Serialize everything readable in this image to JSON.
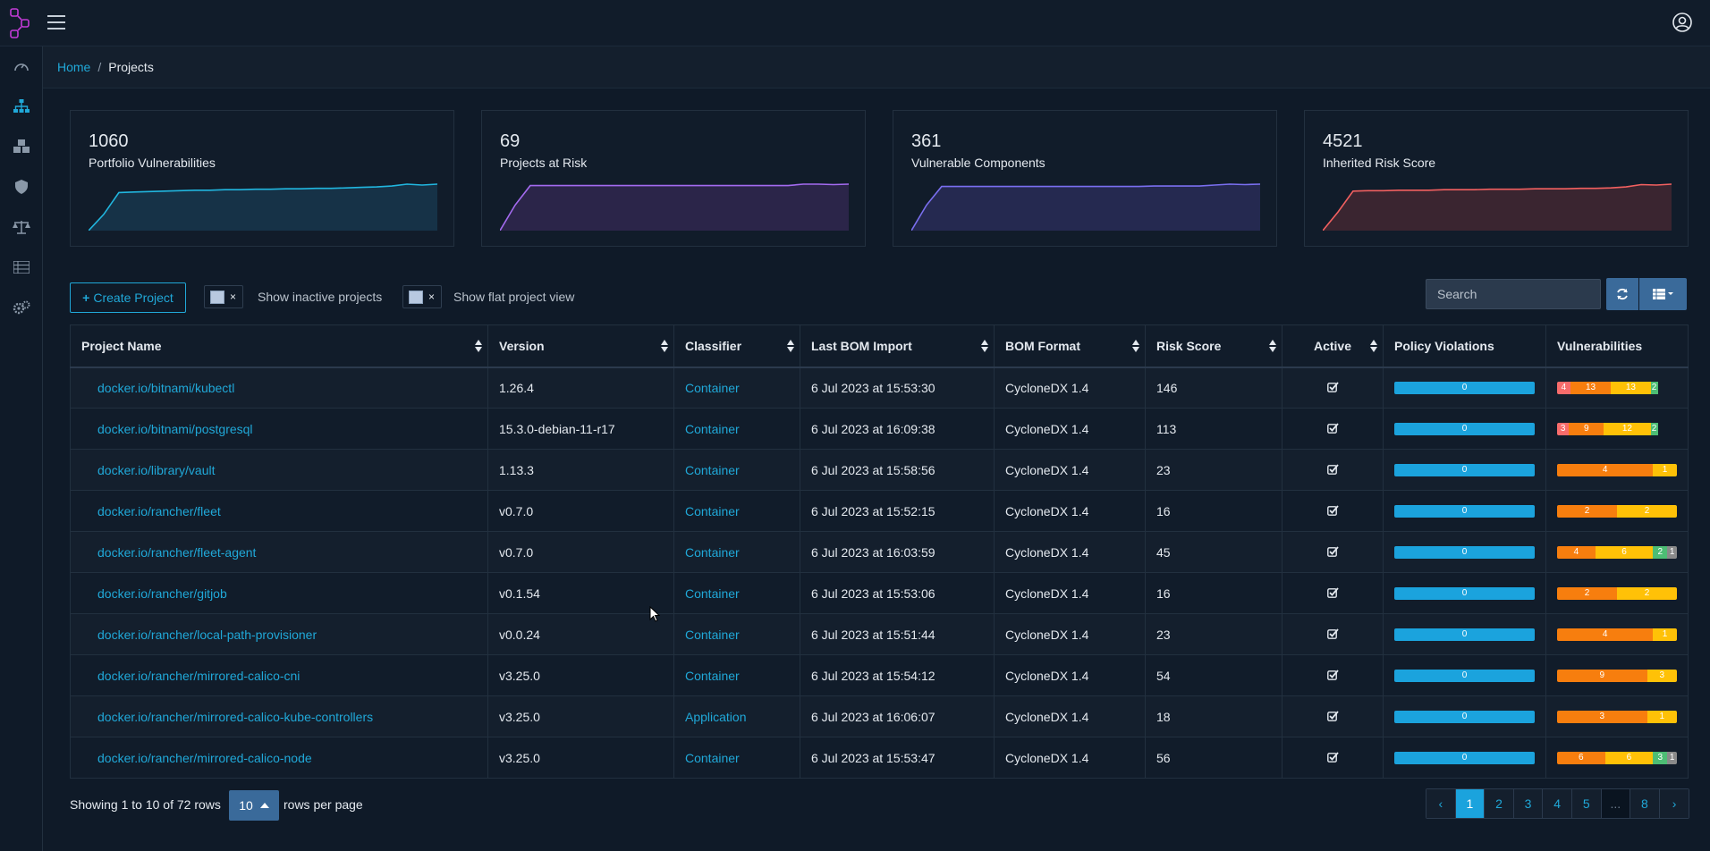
{
  "breadcrumb": {
    "home": "Home",
    "current": "Projects"
  },
  "metrics": [
    {
      "value": "1060",
      "label": "Portfolio Vulnerabilities",
      "color": "#21b6df",
      "fill": "#163247",
      "trend": [
        0,
        0.35,
        0.82,
        0.83,
        0.84,
        0.85,
        0.86,
        0.87,
        0.87,
        0.88,
        0.88,
        0.89,
        0.89,
        0.9,
        0.9,
        0.91,
        0.91,
        0.92,
        0.93,
        0.94,
        0.96,
        1.0,
        0.98,
        1.0
      ]
    },
    {
      "value": "69",
      "label": "Projects at Risk",
      "color": "#a46bf0",
      "fill": "#2b2549",
      "trend": [
        0,
        0.55,
        0.97,
        0.97,
        0.97,
        0.97,
        0.97,
        0.97,
        0.97,
        0.97,
        0.97,
        0.97,
        0.97,
        0.97,
        0.97,
        0.97,
        0.97,
        0.97,
        0.97,
        0.97,
        1.0,
        1.0,
        0.99,
        1.0
      ]
    },
    {
      "value": "361",
      "label": "Vulnerable Components",
      "color": "#7a6ff0",
      "fill": "#252950",
      "trend": [
        0,
        0.55,
        0.95,
        0.95,
        0.95,
        0.95,
        0.95,
        0.95,
        0.95,
        0.95,
        0.95,
        0.95,
        0.95,
        0.95,
        0.95,
        0.95,
        0.96,
        0.96,
        0.96,
        0.96,
        0.98,
        1.0,
        0.99,
        1.0
      ]
    },
    {
      "value": "4521",
      "label": "Inherited Risk Score",
      "color": "#f26060",
      "fill": "#3a2530",
      "trend": [
        0,
        0.4,
        0.85,
        0.86,
        0.86,
        0.87,
        0.87,
        0.87,
        0.88,
        0.88,
        0.88,
        0.89,
        0.89,
        0.89,
        0.9,
        0.9,
        0.9,
        0.91,
        0.91,
        0.92,
        0.94,
        0.99,
        0.98,
        1.0
      ]
    }
  ],
  "toolbar": {
    "create_label": "Create Project",
    "inactive_label": "Show inactive projects",
    "flat_label": "Show flat project view",
    "search_placeholder": "Search",
    "toggle_x": "×"
  },
  "table": {
    "headers": [
      "Project Name",
      "Version",
      "Classifier",
      "Last BOM Import",
      "BOM Format",
      "Risk Score",
      "Active",
      "Policy Violations",
      "Vulnerabilities"
    ],
    "rows": [
      {
        "name": "docker.io/bitnami/kubectl",
        "version": "1.26.4",
        "classifier": "Container",
        "last_import": "6 Jul 2023 at 15:53:30",
        "bom_format": "CycloneDX 1.4",
        "risk": "146",
        "policy": "0",
        "vulns": [
          {
            "v": "4",
            "c": "#f86c6b",
            "w": 11
          },
          {
            "v": "13",
            "c": "#f77e0e",
            "w": 34
          },
          {
            "v": "13",
            "c": "#ffc107",
            "w": 33
          },
          {
            "v": "2",
            "c": "#4dbd74",
            "w": 6
          }
        ]
      },
      {
        "name": "docker.io/bitnami/postgresql",
        "version": "15.3.0-debian-11-r17",
        "classifier": "Container",
        "last_import": "6 Jul 2023 at 16:09:38",
        "bom_format": "CycloneDX 1.4",
        "risk": "113",
        "policy": "0",
        "vulns": [
          {
            "v": "3",
            "c": "#f86c6b",
            "w": 10
          },
          {
            "v": "9",
            "c": "#f77e0e",
            "w": 29
          },
          {
            "v": "12",
            "c": "#ffc107",
            "w": 39
          },
          {
            "v": "2",
            "c": "#4dbd74",
            "w": 6
          }
        ]
      },
      {
        "name": "docker.io/library/vault",
        "version": "1.13.3",
        "classifier": "Container",
        "last_import": "6 Jul 2023 at 15:58:56",
        "bom_format": "CycloneDX 1.4",
        "risk": "23",
        "policy": "0",
        "vulns": [
          {
            "v": "4",
            "c": "#f77e0e",
            "w": 80
          },
          {
            "v": "1",
            "c": "#ffc107",
            "w": 20
          }
        ]
      },
      {
        "name": "docker.io/rancher/fleet",
        "version": "v0.7.0",
        "classifier": "Container",
        "last_import": "6 Jul 2023 at 15:52:15",
        "bom_format": "CycloneDX 1.4",
        "risk": "16",
        "policy": "0",
        "vulns": [
          {
            "v": "2",
            "c": "#f77e0e",
            "w": 50
          },
          {
            "v": "2",
            "c": "#ffc107",
            "w": 50
          }
        ]
      },
      {
        "name": "docker.io/rancher/fleet-agent",
        "version": "v0.7.0",
        "classifier": "Container",
        "last_import": "6 Jul 2023 at 16:03:59",
        "bom_format": "CycloneDX 1.4",
        "risk": "45",
        "policy": "0",
        "vulns": [
          {
            "v": "4",
            "c": "#f77e0e",
            "w": 32
          },
          {
            "v": "6",
            "c": "#ffc107",
            "w": 48
          },
          {
            "v": "2",
            "c": "#4dbd74",
            "w": 12
          },
          {
            "v": "1",
            "c": "#8a8a8a",
            "w": 8
          }
        ]
      },
      {
        "name": "docker.io/rancher/gitjob",
        "version": "v0.1.54",
        "classifier": "Container",
        "last_import": "6 Jul 2023 at 15:53:06",
        "bom_format": "CycloneDX 1.4",
        "risk": "16",
        "policy": "0",
        "vulns": [
          {
            "v": "2",
            "c": "#f77e0e",
            "w": 50
          },
          {
            "v": "2",
            "c": "#ffc107",
            "w": 50
          }
        ]
      },
      {
        "name": "docker.io/rancher/local-path-provisioner",
        "version": "v0.0.24",
        "classifier": "Container",
        "last_import": "6 Jul 2023 at 15:51:44",
        "bom_format": "CycloneDX 1.4",
        "risk": "23",
        "policy": "0",
        "vulns": [
          {
            "v": "4",
            "c": "#f77e0e",
            "w": 80
          },
          {
            "v": "1",
            "c": "#ffc107",
            "w": 20
          }
        ]
      },
      {
        "name": "docker.io/rancher/mirrored-calico-cni",
        "version": "v3.25.0",
        "classifier": "Container",
        "last_import": "6 Jul 2023 at 15:54:12",
        "bom_format": "CycloneDX 1.4",
        "risk": "54",
        "policy": "0",
        "vulns": [
          {
            "v": "9",
            "c": "#f77e0e",
            "w": 75
          },
          {
            "v": "3",
            "c": "#ffc107",
            "w": 25
          }
        ]
      },
      {
        "name": "docker.io/rancher/mirrored-calico-kube-controllers",
        "version": "v3.25.0",
        "classifier": "Application",
        "last_import": "6 Jul 2023 at 16:06:07",
        "bom_format": "CycloneDX 1.4",
        "risk": "18",
        "policy": "0",
        "vulns": [
          {
            "v": "3",
            "c": "#f77e0e",
            "w": 75
          },
          {
            "v": "1",
            "c": "#ffc107",
            "w": 25
          }
        ]
      },
      {
        "name": "docker.io/rancher/mirrored-calico-node",
        "version": "v3.25.0",
        "classifier": "Container",
        "last_import": "6 Jul 2023 at 15:53:47",
        "bom_format": "CycloneDX 1.4",
        "risk": "56",
        "policy": "0",
        "vulns": [
          {
            "v": "6",
            "c": "#f77e0e",
            "w": 40
          },
          {
            "v": "6",
            "c": "#ffc107",
            "w": 40
          },
          {
            "v": "3",
            "c": "#4dbd74",
            "w": 12
          },
          {
            "v": "1",
            "c": "#8a8a8a",
            "w": 8
          }
        ]
      }
    ]
  },
  "footer": {
    "showing": "Showing 1 to 10 of 72 rows",
    "rows_per_page": "10",
    "rows_label": "rows per page",
    "pages": [
      "‹",
      "1",
      "2",
      "3",
      "4",
      "5",
      "...",
      "8",
      "›"
    ],
    "active_page": "1"
  }
}
